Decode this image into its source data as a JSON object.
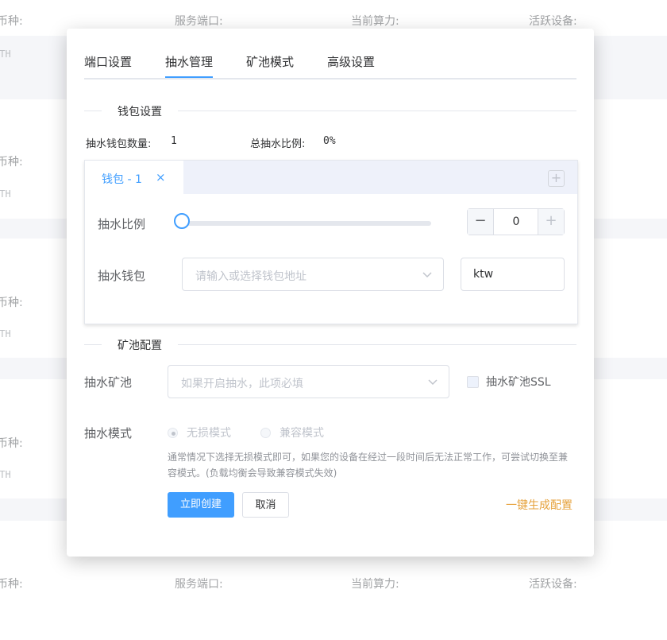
{
  "background": {
    "labels": [
      "币种:",
      "服务端口:",
      "当前算力:",
      "活跃设备:"
    ],
    "coin": "ETH"
  },
  "tabs": [
    {
      "label": "端口设置"
    },
    {
      "label": "抽水管理"
    },
    {
      "label": "矿池模式"
    },
    {
      "label": "高级设置"
    }
  ],
  "active_tab": "抽水管理",
  "wallet_section": {
    "title": "钱包设置",
    "count_label": "抽水钱包数量:",
    "count_value": "1",
    "ratio_label": "总抽水比例:",
    "ratio_value": "0%",
    "wallet_tab_label": "钱包 - 1",
    "close_glyph": "×",
    "add_glyph": "+",
    "ratio_field_label": "抽水比例",
    "ratio_slider_value": 0,
    "stepper_minus": "−",
    "stepper_plus": "+",
    "stepper_value": "0",
    "wallet_field_label": "抽水钱包",
    "wallet_placeholder": "请输入或选择钱包地址",
    "wallet_name_value": "ktw"
  },
  "pool_section": {
    "title": "矿池配置",
    "pool_label": "抽水矿池",
    "pool_placeholder": "如果开启抽水，此项必填",
    "ssl_label": "抽水矿池SSL",
    "ssl_checked": false,
    "mode_label": "抽水模式",
    "mode_options": [
      "无损模式",
      "兼容模式"
    ],
    "mode_selected": "无损模式",
    "hint": "通常情况下选择无损模式即可，如果您的设备在经过一段时间后无法正常工作，可尝试切换至兼容模式。(负载均衡会导致兼容模式失效)"
  },
  "actions": {
    "create": "立即创建",
    "cancel": "取消",
    "generate": "一键生成配置"
  },
  "colors": {
    "primary": "#409eff",
    "warning": "#e6a23c"
  }
}
